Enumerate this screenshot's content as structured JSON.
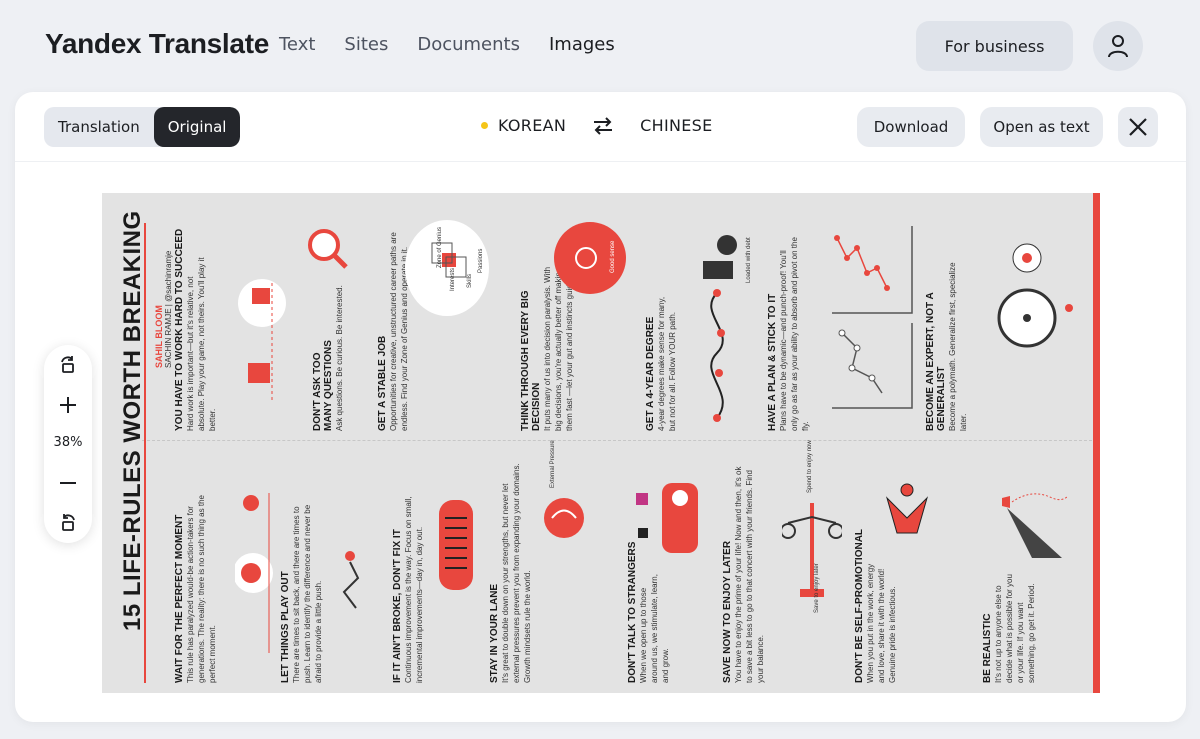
{
  "app": {
    "logo": "Yandex Translate",
    "nav": [
      "Text",
      "Sites",
      "Documents",
      "Images"
    ],
    "active_nav": "Images",
    "business_button": "For business"
  },
  "toolbar": {
    "modes": [
      "Translation",
      "Original"
    ],
    "active_mode": "Original",
    "source_lang": "KOREAN",
    "target_lang": "CHINESE",
    "download": "Download",
    "open_as_text": "Open as text"
  },
  "zoom": {
    "level": "38%"
  },
  "document": {
    "title": "15 LIFE-RULES WORTH BREAKING",
    "author_line": "SACHIN RAMJE | @sachinramje",
    "author_name": "SAHIL BLOOM",
    "rules": [
      {
        "title": "YOU HAVE TO WORK HARD TO SUCCEED",
        "body": "Hard work is important—but it's relative, not absolute. Play your game, not theirs. You'll play it better."
      },
      {
        "title": "DON'T ASK TOO MANY QUESTIONS",
        "body": "Ask questions. Be curious. Be interested."
      },
      {
        "title": "GET A STABLE JOB",
        "body": "Opportunities for creative, unstructured career paths are endless. Find your Zone of Genius and operate in it."
      },
      {
        "title": "THINK THROUGH EVERY BIG DECISION",
        "body": "It puts many of us into decision paralysis. With big decisions, you're actually better off making them fast —let your gut and instincts guide you."
      },
      {
        "title": "GET A 4-YEAR DEGREE",
        "body": "4-year degrees make sense for many, but not for all. Follow YOUR path."
      },
      {
        "title": "HAVE A PLAN & STICK TO IT",
        "body": "Plans have to be dynamic—and punch-proof! You'll only go as far as your ability to absorb and pivot on the fly."
      },
      {
        "title": "BECOME AN EXPERT, NOT A GENERALIST",
        "body": "Become a polymath. Generalize first, specialize later."
      },
      {
        "title": "WAIT FOR THE PERFECT MOMENT",
        "body": "This rule has paralyzed would-be action-takers for generations. The reality: there is no such thing as the perfect moment."
      },
      {
        "title": "LET THINGS PLAY OUT",
        "body": "There are times to sit back, and there are times to push. Learn to identify the difference and never be afraid to provide a little push."
      },
      {
        "title": "IF IT AIN'T BROKE, DON'T FIX IT",
        "body": "Continuous improvement is the way. Focus on small, incremental improvements—day in, day out."
      },
      {
        "title": "STAY IN YOUR LANE",
        "body": "It's great to double down on your strengths, but never let external pressures prevent you from expanding your domains. Growth mindsets rule the world."
      },
      {
        "title": "DON'T TALK TO STRANGERS",
        "body": "When we open up to those around us, we stimulate, learn, and grow."
      },
      {
        "title": "SAVE NOW TO ENJOY LATER",
        "body": "You have to enjoy the prime of your life! Now and then, it's ok to save a bit less to go to that concert with your friends. Find your balance."
      },
      {
        "title": "DON'T BE SELF-PROMOTIONAL",
        "body": "When you put in the work, energy and love, share it with the world! Genuine pride is infectious."
      },
      {
        "title": "BE REALISTIC",
        "body": "It's not up to anyone else to decide what is possible for you or your life. If you want something, go get it. Period."
      }
    ],
    "labels": {
      "zone_of_genius": "Zone of Genius",
      "interests": "Interests",
      "skills": "Skills",
      "passions": "Passions",
      "good_sense": "Good sense",
      "loaded_with_debt": "Loaded with debt",
      "external_pressure": "External Pressure",
      "spend_to_enjoy": "Spend to enjoy now",
      "save_to_enjoy": "Save to enjoy later"
    }
  },
  "colors": {
    "accent_red": "#e8473e",
    "dark": "#24262b",
    "button_bg": "#e8ebf0"
  }
}
